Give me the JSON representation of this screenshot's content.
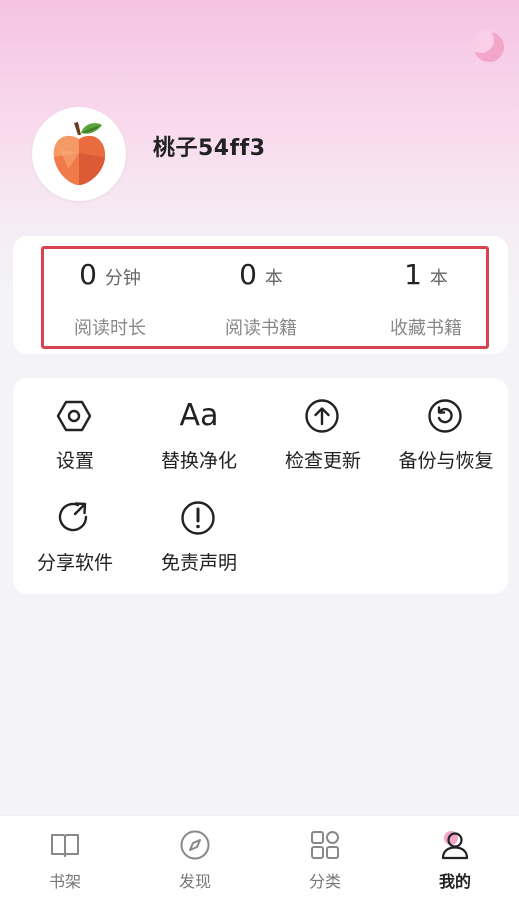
{
  "profile": {
    "username": "桃子54ff3"
  },
  "stats": [
    {
      "value": "0",
      "unit": "分钟",
      "label": "阅读时长"
    },
    {
      "value": "0",
      "unit": "本",
      "label": "阅读书籍"
    },
    {
      "value": "1",
      "unit": "本",
      "label": "收藏书籍"
    }
  ],
  "menu": [
    {
      "label": "设置",
      "icon": "settings-hexagon-icon"
    },
    {
      "label": "替换净化",
      "icon": "text-aa-icon",
      "glyph": "Aa"
    },
    {
      "label": "检查更新",
      "icon": "arrow-up-circle-icon"
    },
    {
      "label": "备份与恢复",
      "icon": "restore-circle-icon"
    },
    {
      "label": "分享软件",
      "icon": "share-arrow-icon"
    },
    {
      "label": "免责声明",
      "icon": "exclamation-circle-icon"
    }
  ],
  "tabs": [
    {
      "label": "书架",
      "icon": "book-icon"
    },
    {
      "label": "发现",
      "icon": "compass-icon"
    },
    {
      "label": "分类",
      "icon": "category-grid-icon"
    },
    {
      "label": "我的",
      "icon": "user-icon",
      "active": true
    }
  ],
  "colors": {
    "accent": "#f2a6c8",
    "highlight_border": "#d8434f"
  }
}
